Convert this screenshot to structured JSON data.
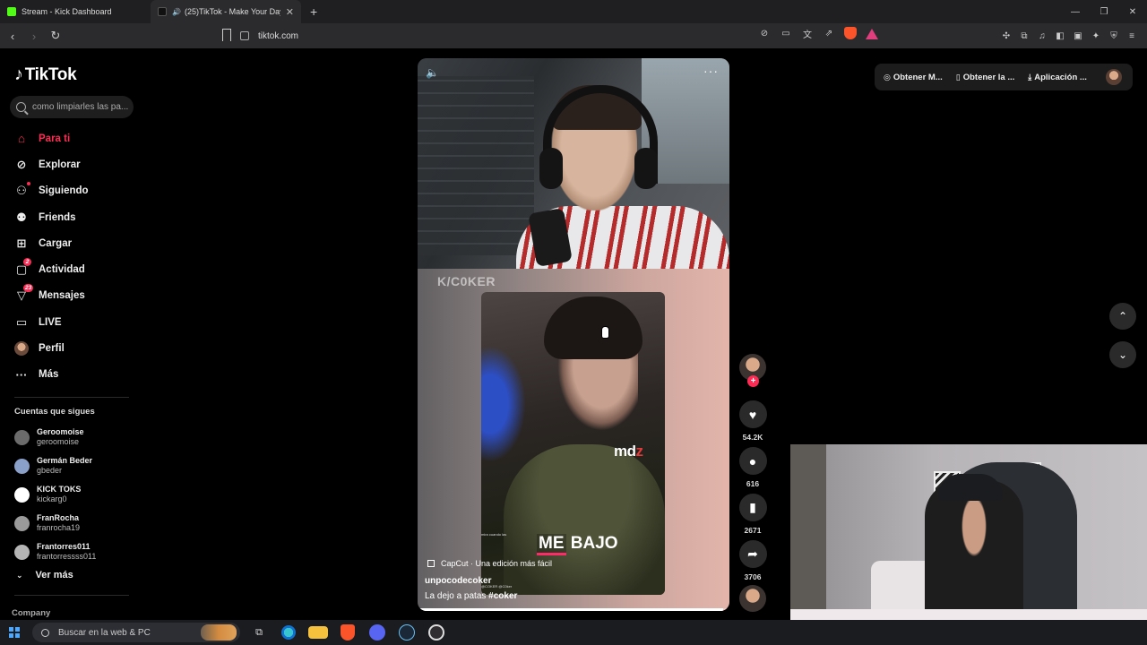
{
  "browser": {
    "tabs": [
      {
        "title": "Stream - Kick Dashboard",
        "active": false
      },
      {
        "title": "(25)TikTok - Make Your Day",
        "active": true
      }
    ],
    "url": "tiktok.com"
  },
  "sidebar": {
    "logo": "TikTok",
    "search_placeholder": "como limpiarles las pa...",
    "nav": [
      {
        "label": "Para ti",
        "active": true
      },
      {
        "label": "Explorar"
      },
      {
        "label": "Siguiendo"
      },
      {
        "label": "Friends"
      },
      {
        "label": "Cargar"
      },
      {
        "label": "Actividad",
        "badge": "2"
      },
      {
        "label": "Mensajes",
        "badge": "23"
      },
      {
        "label": "LIVE"
      },
      {
        "label": "Perfil"
      },
      {
        "label": "Más"
      }
    ],
    "following_title": "Cuentas que sigues",
    "following": [
      {
        "name": "Geroomoise",
        "user": "geroomoise",
        "color": "#6b6b6b"
      },
      {
        "name": "Germán Beder",
        "user": "gbeder",
        "color": "#8aa0c8"
      },
      {
        "name": "KICK TOKS",
        "user": "kickarg0",
        "color": "#ffffff"
      },
      {
        "name": "FranRocha",
        "user": "franrocha19",
        "color": "#9a9a9a"
      },
      {
        "name": "Frantorres011",
        "user": "frantorressss011",
        "color": "#b5b5b5"
      }
    ],
    "see_more": "Ver más",
    "company": "Company"
  },
  "video": {
    "overlay_logo": "K/C0KER",
    "watermark": "md",
    "watermark_z": "z",
    "caption_me": "ME",
    "caption_rest": "BAJO",
    "tiny_caption": "mira cuando las",
    "tiny_credit": "@COKER @C0ker",
    "capcut_label": "CapCut · Una edición más fácil",
    "author": "unpocodecoker",
    "description": "La dejo a patas",
    "hashtag": "#coker",
    "progress": 0.98
  },
  "actions": {
    "like_count": "54.2K",
    "comment_count": "616",
    "save_count": "2671",
    "share_count": "3706"
  },
  "header": {
    "pills": [
      "Obtener M...",
      "Obtener la ...",
      "Aplicación ..."
    ]
  },
  "taskbar": {
    "search_placeholder": "Buscar en la web & PC"
  }
}
